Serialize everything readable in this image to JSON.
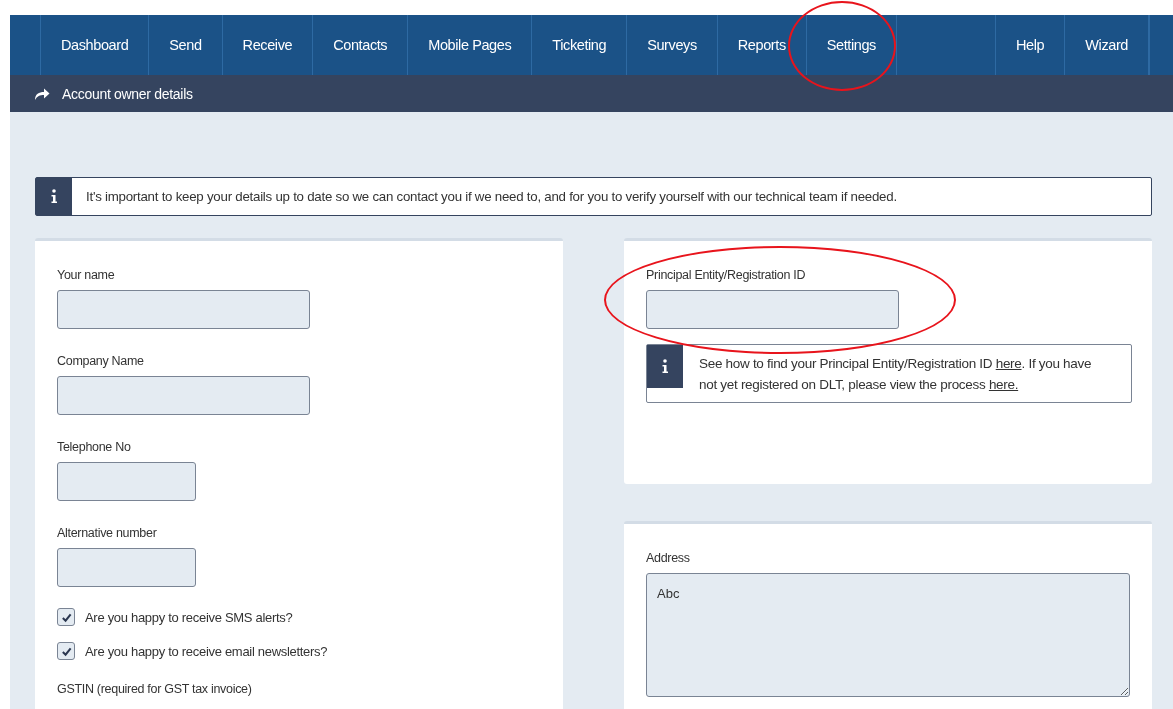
{
  "nav": {
    "items": [
      {
        "label": "Dashboard"
      },
      {
        "label": "Send"
      },
      {
        "label": "Receive"
      },
      {
        "label": "Contacts"
      },
      {
        "label": "Mobile Pages"
      },
      {
        "label": "Ticketing"
      },
      {
        "label": "Surveys"
      },
      {
        "label": "Reports"
      },
      {
        "label": "Settings"
      }
    ],
    "right_items": [
      {
        "label": "Help"
      },
      {
        "label": "Wizard"
      }
    ]
  },
  "breadcrumb": {
    "title": "Account owner details"
  },
  "notice": {
    "text": "It's important to keep your details up to date so we can contact you if we need to, and for you to verify yourself with our technical team if needed."
  },
  "left_form": {
    "fields": [
      {
        "label": "Your name",
        "kind": "long"
      },
      {
        "label": "Company Name",
        "kind": "long"
      },
      {
        "label": "Telephone No",
        "kind": "short"
      },
      {
        "label": "Alternative number",
        "kind": "short"
      }
    ],
    "checkboxes": [
      {
        "label": "Are you happy to receive SMS alerts?",
        "checked": true
      },
      {
        "label": "Are you happy to receive email newsletters?",
        "checked": true
      }
    ],
    "gstin_label": "GSTIN (required for GST tax invoice)"
  },
  "registration": {
    "label": "Principal Entity/Registration ID",
    "info": [
      {
        "kind": "text",
        "text": "See how to find your Principal Entity/Registration ID "
      },
      {
        "kind": "link",
        "text": "here"
      },
      {
        "kind": "text",
        "text": ". If you have not yet registered on DLT, please view the process "
      },
      {
        "kind": "link",
        "text": "here."
      }
    ]
  },
  "address": {
    "label": "Address",
    "value": "Abc"
  }
}
